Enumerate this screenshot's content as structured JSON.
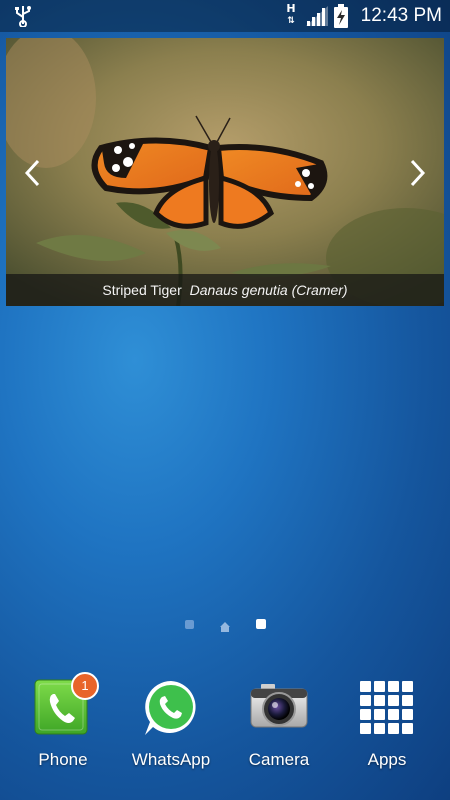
{
  "status_bar": {
    "network_type": "H",
    "time": "12:43 PM"
  },
  "widget": {
    "caption_common": "Striped Tiger",
    "caption_scientific": "Danaus genutia (Cramer)"
  },
  "dock": {
    "apps": [
      {
        "label": "Phone",
        "badge": "1"
      },
      {
        "label": "WhatsApp"
      },
      {
        "label": "Camera"
      },
      {
        "label": "Apps"
      }
    ]
  },
  "colors": {
    "phone_green": "#5cc23a",
    "whatsapp_green": "#3ec04c",
    "badge_orange": "#e8642a",
    "butterfly_orange": "#f07a1c"
  }
}
